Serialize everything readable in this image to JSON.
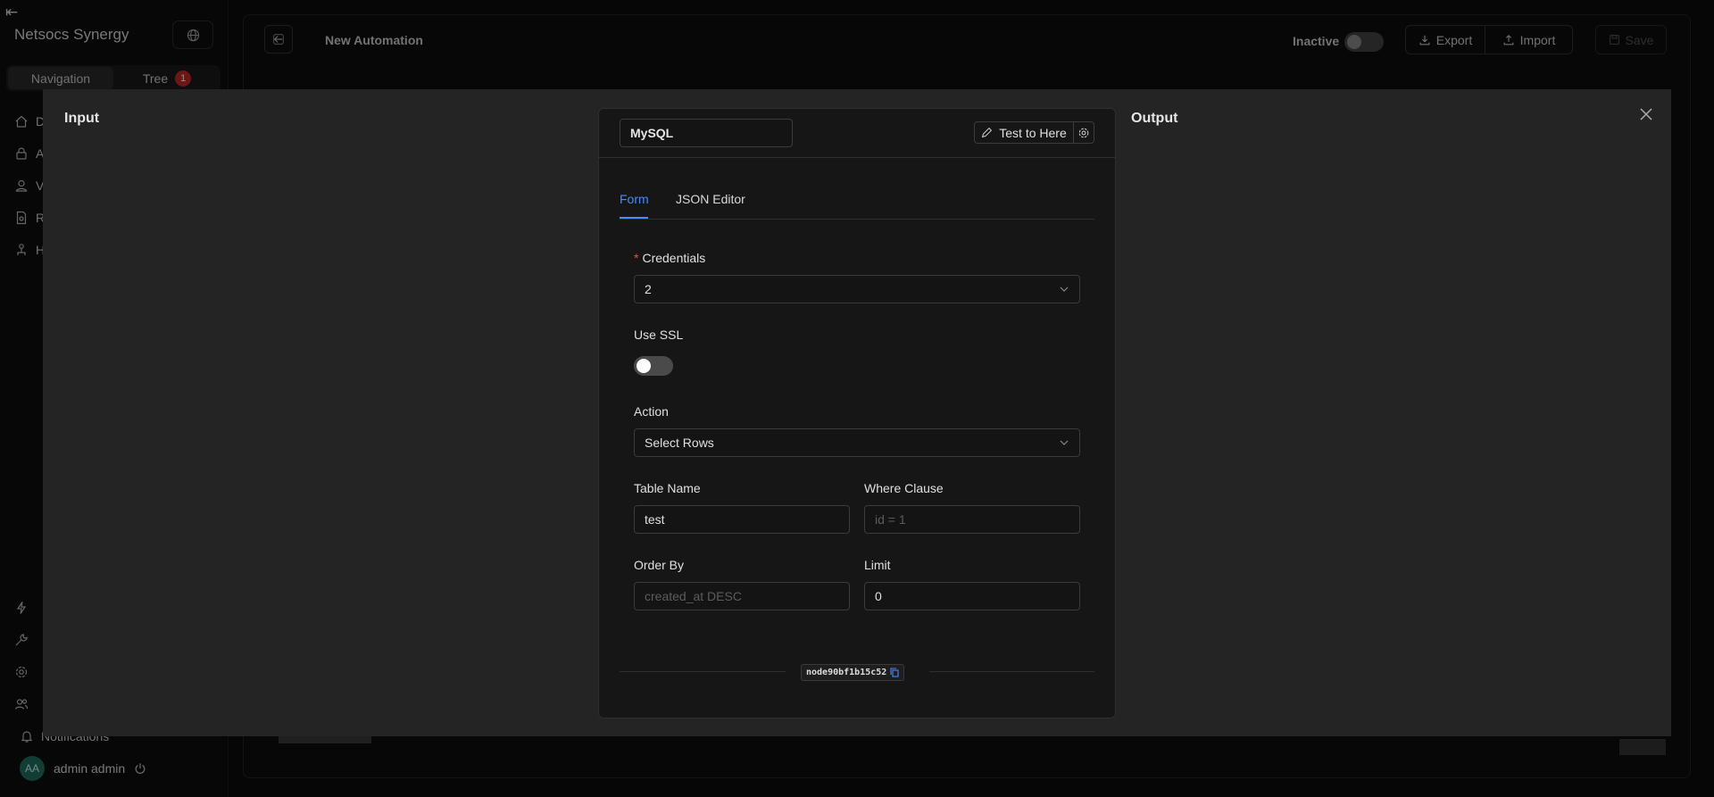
{
  "sidebar": {
    "brand": "Netsocs Synergy",
    "tabs": [
      {
        "label": "Navigation"
      },
      {
        "label": "Tree",
        "badge": "1"
      }
    ],
    "items": [
      {
        "label": "D",
        "icon": "home-icon"
      },
      {
        "label": "A",
        "icon": "lock-icon"
      },
      {
        "label": "V",
        "icon": "user-icon"
      },
      {
        "label": "R",
        "icon": "report-icon"
      },
      {
        "label": "H",
        "icon": "hierarchy-icon"
      }
    ],
    "bottom_items": [
      {
        "label": "",
        "icon": "lightning-icon"
      },
      {
        "label": "",
        "icon": "wrench-icon"
      },
      {
        "label": "",
        "icon": "gear-icon"
      },
      {
        "label": "",
        "icon": "users-icon"
      },
      {
        "label": "Notifications",
        "icon": "bell-icon"
      }
    ],
    "user": {
      "initials": "AA",
      "name": "admin admin"
    }
  },
  "header": {
    "title": "New Automation",
    "status_label": "Inactive",
    "export_label": "Export",
    "import_label": "Import",
    "save_label": "Save"
  },
  "modal": {
    "input_title": "Input",
    "output_title": "Output",
    "node": {
      "name": "MySQL",
      "test_label": "Test to Here",
      "tabs": [
        {
          "label": "Form",
          "active": true
        },
        {
          "label": "JSON Editor",
          "active": false
        }
      ],
      "fields": {
        "credentials": {
          "label": "Credentials",
          "required_mark": "*",
          "value": "2"
        },
        "use_ssl": {
          "label": "Use SSL",
          "on": false
        },
        "action": {
          "label": "Action",
          "value": "Select Rows"
        },
        "table_name": {
          "label": "Table Name",
          "value": "test"
        },
        "where_clause": {
          "label": "Where Clause",
          "value": "",
          "placeholder": "id = 1"
        },
        "order_by": {
          "label": "Order By",
          "value": "",
          "placeholder": "created_at DESC"
        },
        "limit": {
          "label": "Limit",
          "value": "0"
        }
      },
      "node_id": "node90bf1b15c52"
    }
  },
  "colors": {
    "accent": "#4c8bf5",
    "badge": "#c62828",
    "required": "#e05252"
  }
}
